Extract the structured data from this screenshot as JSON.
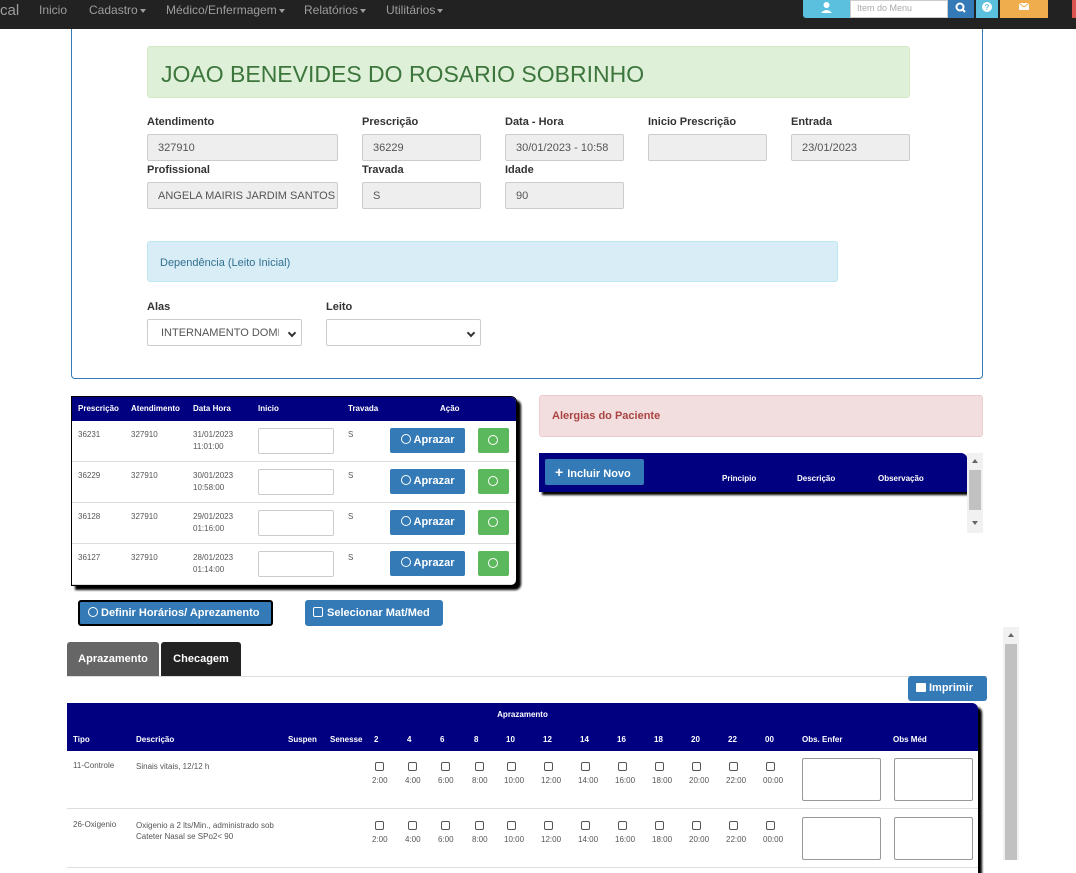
{
  "nav": {
    "brand": "cal",
    "items": [
      "Inicio",
      "Cadastro",
      "Médico/Enfermagem",
      "Relatórios",
      "Utilitários"
    ],
    "search_placeholder": "Item do Menu"
  },
  "patient": {
    "name": "JOAO BENEVIDES DO ROSARIO SOBRINHO",
    "atendimento_label": "Atendimento",
    "atendimento": "327910",
    "prescricao_label": "Prescrição",
    "prescricao": "36229",
    "datahora_label": "Data - Hora",
    "datahora": "30/01/2023 - 10:58",
    "inicio_label": "Inicio Prescrição",
    "inicio": "",
    "entrada_label": "Entrada",
    "entrada": "23/01/2023",
    "profissional_label": "Profissional",
    "profissional": "ANGELA MAIRIS JARDIM SANTOS",
    "travada_label": "Travada",
    "travada": "S",
    "idade_label": "Idade",
    "idade": "90",
    "dependencia": "Dependência (Leito Inicial)",
    "alas_label": "Alas",
    "alas": "INTERNAMENTO DOMICILIAR",
    "leito_label": "Leito",
    "leito": ""
  },
  "prescricoes": {
    "headers": [
      "Prescrição",
      "Atendimento",
      "Data Hora",
      "Inicio",
      "Travada",
      "Ação"
    ],
    "aprazar_label": "Aprazar",
    "rows": [
      {
        "presc": "36231",
        "atend": "327910",
        "date": "31/01/2023",
        "time": "11:01:00",
        "travada": "S"
      },
      {
        "presc": "36229",
        "atend": "327910",
        "date": "30/01/2023",
        "time": "10:58:00",
        "travada": "S"
      },
      {
        "presc": "36128",
        "atend": "327910",
        "date": "29/01/2023",
        "time": "01:16:00",
        "travada": "S"
      },
      {
        "presc": "36127",
        "atend": "327910",
        "date": "28/01/2023",
        "time": "01:14:00",
        "travada": "S"
      }
    ]
  },
  "alergias": {
    "title": "Alergias do Paciente",
    "incluir_label": "Incluir Novo",
    "headers": [
      "Principio",
      "Descrição",
      "Observação"
    ]
  },
  "actions": {
    "definir_label": "Definir Horários/ Aprezamento",
    "selecionar_label": "Selecionar Mat/Med"
  },
  "tabs": [
    "Aprazamento",
    "Checagem"
  ],
  "print_label": "Imprimir",
  "aprazamento": {
    "title": "Aprazamento",
    "headers": {
      "tipo": "Tipo",
      "descricao": "Descrição",
      "suspen": "Suspen",
      "senesse": "Senesse",
      "obs_enf": "Obs. Enfer",
      "obs_med": "Obs Méd"
    },
    "hours": [
      "2",
      "4",
      "6",
      "8",
      "10",
      "12",
      "14",
      "16",
      "18",
      "20",
      "22",
      "00"
    ],
    "times": [
      "2:00",
      "4:00",
      "6:00",
      "8:00",
      "10:00",
      "12:00",
      "14:00",
      "16:00",
      "18:00",
      "20:00",
      "22:00",
      "00:00"
    ],
    "rows": [
      {
        "tipo": "11-Controle",
        "descricao": "Sinais vitais, 12/12 h"
      },
      {
        "tipo": "26-Oxigenio",
        "descricao": "Oxigenio a 2 lts/Min., administrado sob Cateter Nasal se SPo2< 90"
      }
    ]
  }
}
